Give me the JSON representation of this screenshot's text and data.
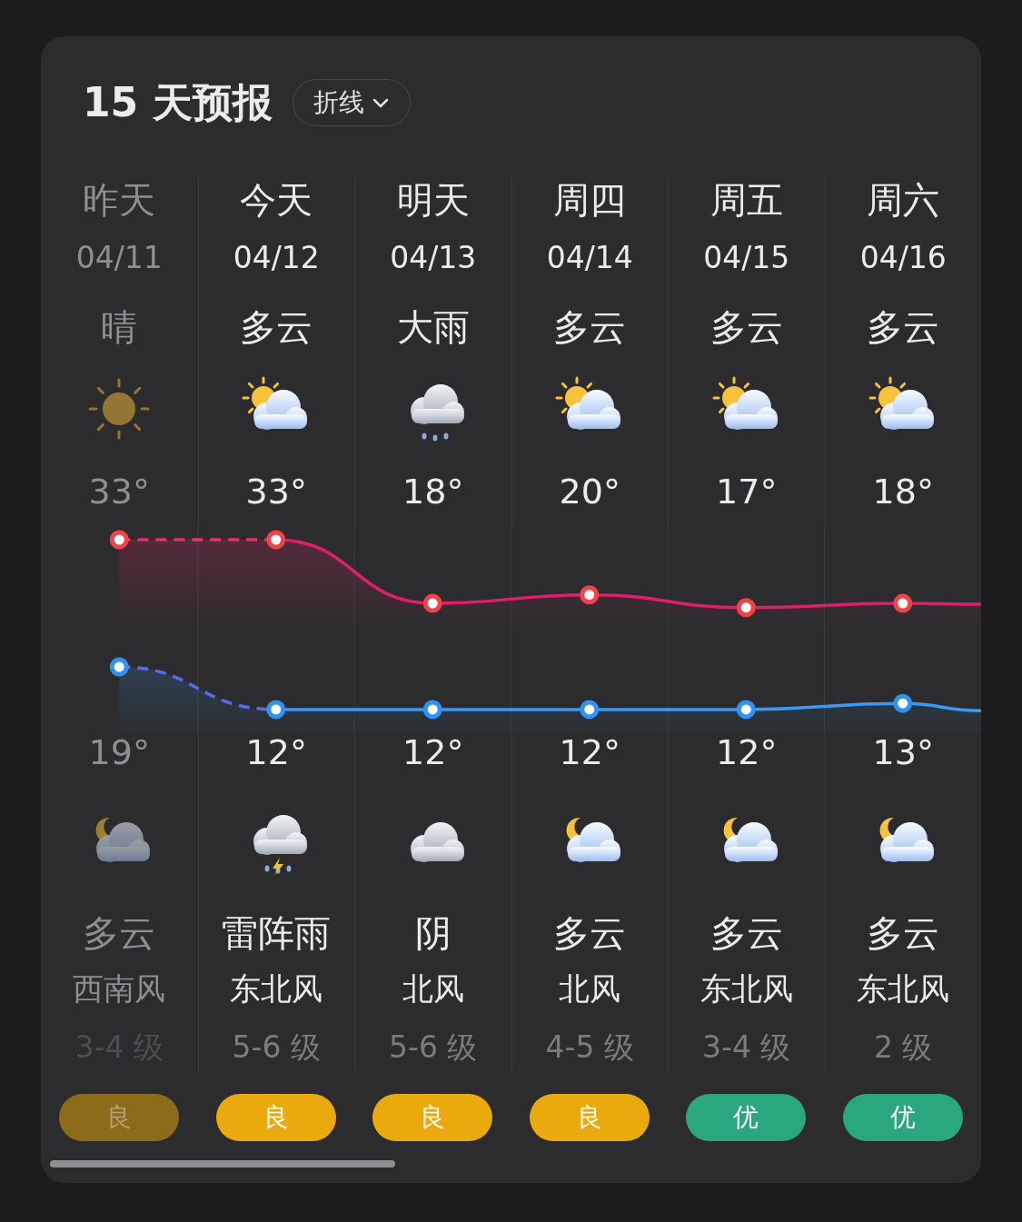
{
  "header": {
    "title": "15 天预报",
    "view_selector": {
      "label": "折线"
    }
  },
  "days": [
    {
      "name": "昨天",
      "date": "04/11",
      "day_condition": "晴",
      "day_icon": {
        "kind": "sunny"
      },
      "high": "33°",
      "low": "19°",
      "night_icon": {
        "kind": "night_cloudy"
      },
      "night_condition": "多云",
      "wind_dir": "西南风",
      "wind_level": "3-4 级",
      "aqi": {
        "label": "良",
        "color": "#8c6b1b"
      },
      "past": true
    },
    {
      "name": "今天",
      "date": "04/12",
      "day_condition": "多云",
      "day_icon": {
        "kind": "partly_cloudy"
      },
      "high": "33°",
      "low": "12°",
      "night_icon": {
        "kind": "thunder"
      },
      "night_condition": "雷阵雨",
      "wind_dir": "东北风",
      "wind_level": "5-6 级",
      "aqi": {
        "label": "良",
        "color": "#eaa90d"
      },
      "past": false
    },
    {
      "name": "明天",
      "date": "04/13",
      "day_condition": "大雨",
      "day_icon": {
        "kind": "rain"
      },
      "high": "18°",
      "low": "12°",
      "night_icon": {
        "kind": "overcast"
      },
      "night_condition": "阴",
      "wind_dir": "北风",
      "wind_level": "5-6 级",
      "aqi": {
        "label": "良",
        "color": "#eaa90d"
      },
      "past": false
    },
    {
      "name": "周四",
      "date": "04/14",
      "day_condition": "多云",
      "day_icon": {
        "kind": "partly_cloudy"
      },
      "high": "20°",
      "low": "12°",
      "night_icon": {
        "kind": "night_cloudy"
      },
      "night_condition": "多云",
      "wind_dir": "北风",
      "wind_level": "4-5 级",
      "aqi": {
        "label": "良",
        "color": "#eaa90d"
      },
      "past": false
    },
    {
      "name": "周五",
      "date": "04/15",
      "day_condition": "多云",
      "day_icon": {
        "kind": "partly_cloudy"
      },
      "high": "17°",
      "low": "12°",
      "night_icon": {
        "kind": "night_cloudy"
      },
      "night_condition": "多云",
      "wind_dir": "东北风",
      "wind_level": "3-4 级",
      "aqi": {
        "label": "优",
        "color": "#2aa77f"
      },
      "past": false
    },
    {
      "name": "周六",
      "date": "04/16",
      "day_condition": "多云",
      "day_icon": {
        "kind": "partly_cloudy"
      },
      "high": "18°",
      "low": "13°",
      "night_icon": {
        "kind": "night_cloudy"
      },
      "night_condition": "多云",
      "wind_dir": "东北风",
      "wind_level": "2 级",
      "aqi": {
        "label": "优",
        "color": "#2aa77f"
      },
      "past": false
    }
  ]
}
